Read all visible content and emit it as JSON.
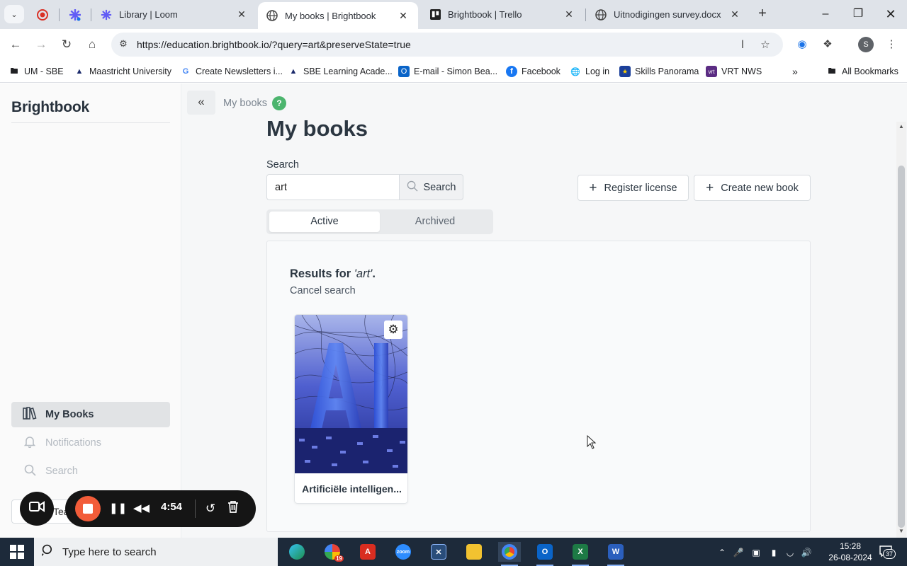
{
  "browser": {
    "tabs": [
      {
        "title": "Library | Loom",
        "active": false
      },
      {
        "title": "My books | Brightbook",
        "active": true
      },
      {
        "title": "Brightbook | Trello",
        "active": false
      },
      {
        "title": "Uitnodigingen survey.docx",
        "active": false
      }
    ],
    "url": "https://education.brightbook.io/?query=art&preserveState=true",
    "profile_initial": "S",
    "bookmarks": [
      "UM - SBE",
      "Maastricht University",
      "Create Newsletters i...",
      "SBE Learning Acade...",
      "E-mail - Simon Bea...",
      "Facebook",
      "Log in",
      "Skills Panorama",
      "VRT NWS"
    ],
    "all_bookmarks": "All Bookmarks"
  },
  "app": {
    "brand": "Brightbook",
    "nav": [
      {
        "label": "My Books",
        "icon": "books-icon",
        "active": true
      },
      {
        "label": "Notifications",
        "icon": "bell-icon",
        "active": false
      },
      {
        "label": "Search",
        "icon": "search-icon",
        "active": false
      }
    ],
    "sidebar_partial_label": "Tea",
    "breadcrumb": "My books",
    "help": "?",
    "page_title": "My books",
    "search": {
      "label": "Search",
      "value": "art",
      "button": "Search"
    },
    "register_license": "Register license",
    "create_new_book": "Create new book",
    "tabs": [
      "Active",
      "Archived"
    ],
    "results_prefix": "Results for ",
    "results_query": "'art'",
    "results_suffix": ".",
    "cancel_search": "Cancel search",
    "books": [
      {
        "title": "Artificiële intelligen...",
        "cover_text": "AI"
      }
    ]
  },
  "loom": {
    "time": "4:54"
  },
  "taskbar": {
    "search_placeholder": "Type here to search",
    "time": "15:28",
    "date": "26-08-2024",
    "notification_count": "37",
    "badge_count": "19"
  },
  "colors": {
    "accent_green": "#4cb56e",
    "loom_record": "#f25c39",
    "taskbar": "#1d2a3a"
  }
}
